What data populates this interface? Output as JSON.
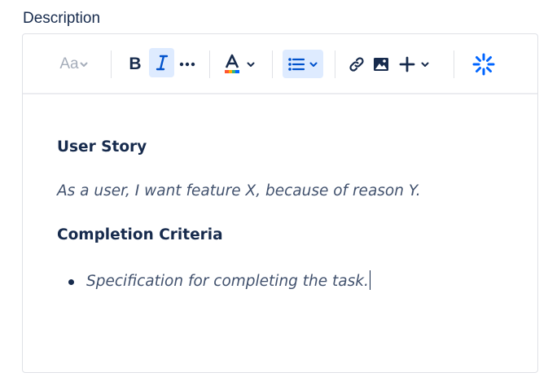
{
  "field": {
    "label": "Description"
  },
  "toolbar": {
    "text_style_label": "Aa",
    "bold_label": "B",
    "italic_active": true,
    "list_active": true,
    "icons": {
      "text_style": "chevron-down-icon",
      "italic": "italic-icon",
      "more": "more-formatting-icon",
      "text_color": "text-color-icon",
      "list": "bullet-list-icon",
      "link": "link-icon",
      "image": "image-icon",
      "insert": "plus-icon",
      "ai": "ai-sparkle-icon"
    },
    "colors": {
      "active_bg": "#deebff",
      "active_fg": "#0052cc",
      "disabled": "#a5adba"
    }
  },
  "content": {
    "heading_story": "User Story",
    "story_text": "As a user, I want feature X, because of reason Y.",
    "heading_criteria": "Completion Criteria",
    "criteria_items": [
      "Specification for completing the task."
    ]
  }
}
